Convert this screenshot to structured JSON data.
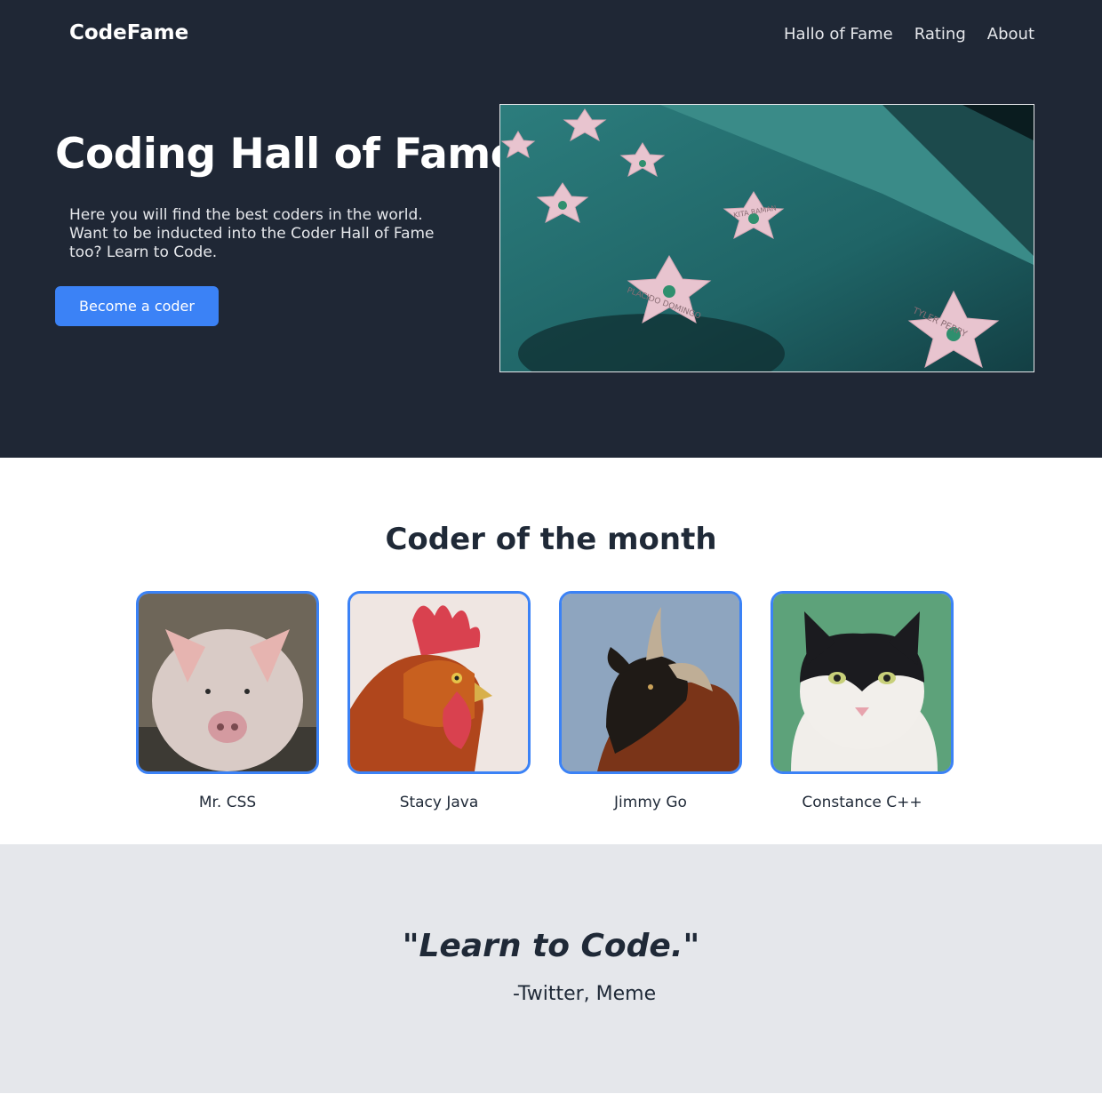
{
  "header": {
    "brand": "CodeFame",
    "nav": [
      "Hallo of Fame",
      "Rating",
      "About"
    ]
  },
  "hero": {
    "title": "Coding Hall of Fame",
    "text": "Here you will find the best coders in the world. Want to be inducted into the Coder Hall of Fame too? Learn to Code.",
    "button": "Become a coder",
    "image_stars": [
      "KITA RAMAN",
      "PLACIDO DOMINGO",
      "TYLER PERRY"
    ]
  },
  "coders": {
    "title": "Coder of the month",
    "items": [
      {
        "name": "Mr. CSS",
        "icon": "pig-photo"
      },
      {
        "name": "Stacy Java",
        "icon": "rooster-photo"
      },
      {
        "name": "Jimmy Go",
        "icon": "goat-photo"
      },
      {
        "name": "Constance C++",
        "icon": "cat-photo"
      }
    ]
  },
  "quote": {
    "text": "\"Learn to Code.\"",
    "author": "-Twitter, Meme"
  },
  "colors": {
    "hero_bg": "#1f2735",
    "accent": "#3b82f6",
    "quote_bg": "#e5e7eb",
    "text_dark": "#1f2937"
  }
}
